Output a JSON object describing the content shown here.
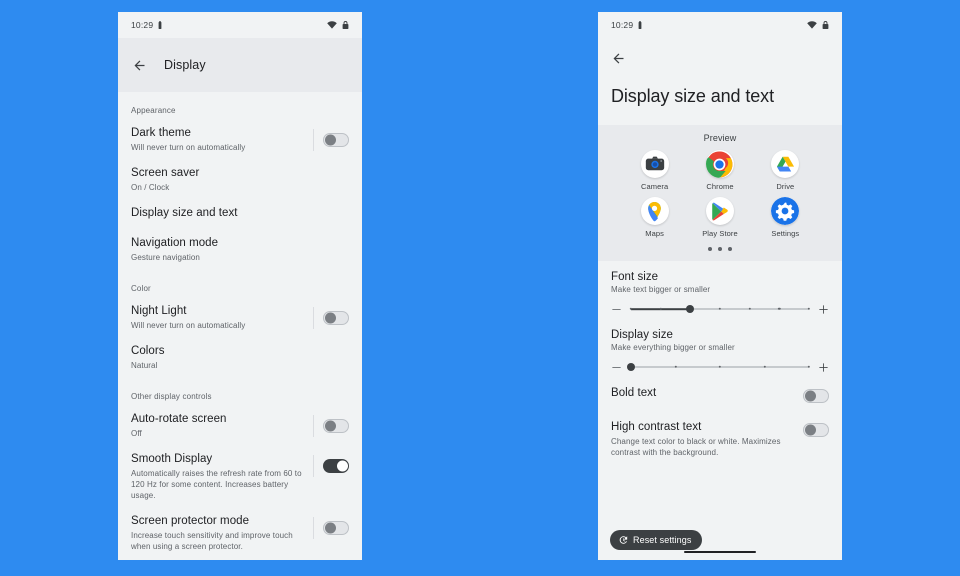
{
  "background_color": "#2e8bf0",
  "screen_bg": "#f1f3f4",
  "accent_dark": "#3c4043",
  "left_phone": {
    "status_bar": {
      "time": "10:29",
      "wifi_icon": "wifi-icon",
      "battery_icon": "battery-icon"
    },
    "appbar": {
      "back_icon": "back-arrow-icon",
      "title": "Display"
    },
    "sections": [
      {
        "header": "Appearance",
        "rows": [
          {
            "title": "Dark theme",
            "subtitle": "Will never turn on automatically",
            "control": "toggle",
            "state": "off"
          },
          {
            "title": "Screen saver",
            "subtitle": "On / Clock",
            "control": "none",
            "state": ""
          },
          {
            "title": "Display size and text",
            "subtitle": "",
            "control": "none",
            "state": ""
          },
          {
            "title": "Navigation mode",
            "subtitle": "Gesture navigation",
            "control": "none",
            "state": ""
          }
        ]
      },
      {
        "header": "Color",
        "rows": [
          {
            "title": "Night Light",
            "subtitle": "Will never turn on automatically",
            "control": "toggle",
            "state": "off"
          },
          {
            "title": "Colors",
            "subtitle": "Natural",
            "control": "none",
            "state": ""
          }
        ]
      },
      {
        "header": "Other display controls",
        "rows": [
          {
            "title": "Auto-rotate screen",
            "subtitle": "Off",
            "control": "toggle",
            "state": "off"
          },
          {
            "title": "Smooth Display",
            "subtitle": "Automatically raises the refresh rate from 60 to 120 Hz for some content. Increases battery usage.",
            "control": "toggle",
            "state": "on"
          },
          {
            "title": "Screen protector mode",
            "subtitle": "Increase touch sensitivity and improve touch when using a screen protector.",
            "control": "toggle",
            "state": "off"
          }
        ]
      }
    ]
  },
  "right_phone": {
    "status_bar": {
      "time": "10:29",
      "wifi_icon": "wifi-icon",
      "battery_icon": "battery-icon"
    },
    "appbar": {
      "back_icon": "back-arrow-icon"
    },
    "page_title": "Display size and text",
    "preview": {
      "label": "Preview",
      "apps": [
        {
          "name": "Camera",
          "icon": "camera-app-icon"
        },
        {
          "name": "Chrome",
          "icon": "chrome-app-icon"
        },
        {
          "name": "Drive",
          "icon": "drive-app-icon"
        },
        {
          "name": "Maps",
          "icon": "maps-app-icon"
        },
        {
          "name": "Play Store",
          "icon": "play-store-app-icon"
        },
        {
          "name": "Settings",
          "icon": "settings-app-icon"
        }
      ],
      "page_dots": 3
    },
    "sliders": [
      {
        "title": "Font size",
        "subtitle": "Make text bigger or smaller",
        "decrease_icon": "minus-icon",
        "increase_icon": "plus-icon",
        "steps": 7,
        "value_index": 2
      },
      {
        "title": "Display size",
        "subtitle": "Make everything bigger or smaller",
        "decrease_icon": "minus-icon",
        "increase_icon": "plus-icon",
        "steps": 5,
        "value_index": 0
      }
    ],
    "switch_rows": [
      {
        "title": "Bold text",
        "subtitle": "",
        "state": "off"
      },
      {
        "title": "High contrast text",
        "subtitle": "Change text color to black or white. Maximizes contrast with the background.",
        "state": "off"
      }
    ],
    "reset_button": {
      "label": "Reset settings",
      "icon": "history-restore-icon"
    },
    "home_indicator": "gesture-home-bar"
  }
}
